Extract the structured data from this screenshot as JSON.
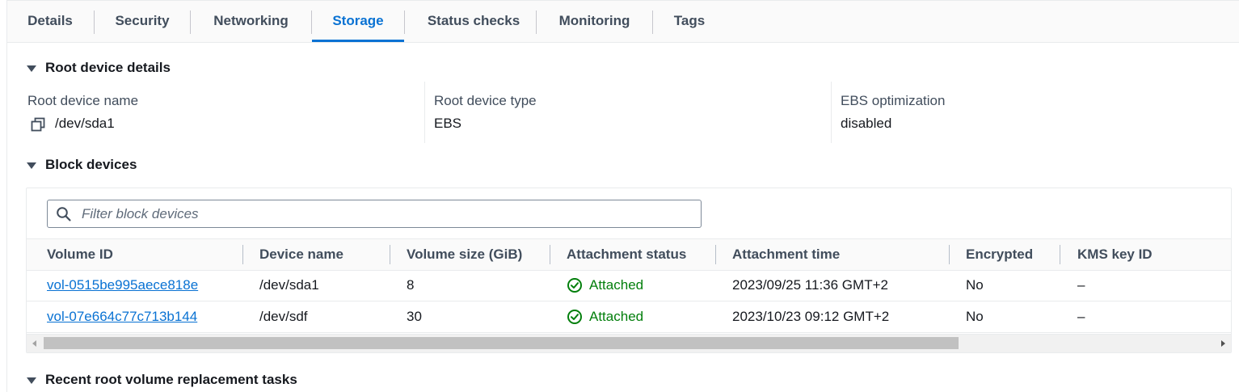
{
  "tabs": [
    {
      "label": "Details",
      "active": false
    },
    {
      "label": "Security",
      "active": false
    },
    {
      "label": "Networking",
      "active": false
    },
    {
      "label": "Storage",
      "active": true
    },
    {
      "label": "Status checks",
      "active": false
    },
    {
      "label": "Monitoring",
      "active": false
    },
    {
      "label": "Tags",
      "active": false
    }
  ],
  "root_device": {
    "section_title": "Root device details",
    "name_label": "Root device name",
    "name_value": "/dev/sda1",
    "type_label": "Root device type",
    "type_value": "EBS",
    "ebs_label": "EBS optimization",
    "ebs_value": "disabled"
  },
  "block_devices": {
    "section_title": "Block devices",
    "filter_placeholder": "Filter block devices",
    "columns": [
      "Volume ID",
      "Device name",
      "Volume size (GiB)",
      "Attachment status",
      "Attachment time",
      "Encrypted",
      "KMS key ID"
    ],
    "rows": [
      {
        "volume_id": "vol-0515be995aece818e",
        "device": "/dev/sda1",
        "size": "8",
        "status": "Attached",
        "time": "2023/09/25 11:36 GMT+2",
        "encrypted": "No",
        "kms": "–"
      },
      {
        "volume_id": "vol-07e664c77c713b144",
        "device": "/dev/sdf",
        "size": "30",
        "status": "Attached",
        "time": "2023/10/23 09:12 GMT+2",
        "encrypted": "No",
        "kms": "–"
      }
    ]
  },
  "replacement": {
    "section_title": "Recent root volume replacement tasks"
  },
  "colors": {
    "accent": "#0972d3",
    "success": "#037f0c",
    "text": "#16191f",
    "label": "#414d5c"
  },
  "icons": [
    "copy-icon",
    "search-icon",
    "caret-down-icon",
    "status-success-icon"
  ]
}
